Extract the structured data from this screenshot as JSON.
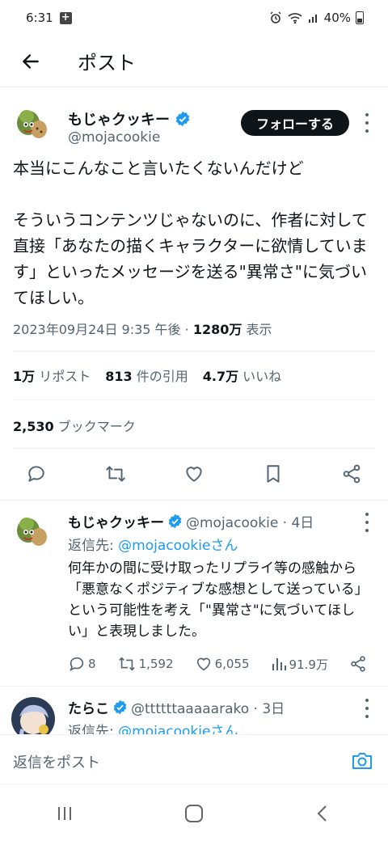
{
  "status_bar": {
    "time": "6:31",
    "battery": "40%"
  },
  "header": {
    "title": "ポスト"
  },
  "post": {
    "author_name": "もじゃクッキー",
    "author_handle": "@mojacookie",
    "follow_label": "フォローする",
    "text": "本当にこんなこと言いたくないんだけど\n\nそういうコンテンツじゃないのに、作者に対して直接「あなたの描くキャラクターに欲情しています」といったメッセージを送る\"異常さ\"に気づいてほしい。",
    "timestamp": "2023年09月24日 9:35 午後 · ",
    "views_count": "1280万",
    "views_label": " 表示",
    "reposts_count": "1万",
    "reposts_label": " リポスト",
    "quotes_count": "813",
    "quotes_label": " 件の引用",
    "likes_count": "4.7万",
    "likes_label": " いいね",
    "bookmarks_count": "2,530",
    "bookmarks_label": " ブックマーク"
  },
  "replies": [
    {
      "name": "もじゃクッキー",
      "handle": "@mojacookie · 4日",
      "reply_to_prefix": "返信先: ",
      "reply_to_link": "@mojacookieさん",
      "text": "何年かの間に受け取ったリプライ等の感触から「悪意なくポジティブな感想として送っている」という可能性を考え「\"異常さ\"に気づいてほしい」と表現しました。",
      "replies": "8",
      "reposts": "1,592",
      "likes": "6,055",
      "views": "91.9万"
    },
    {
      "name": "たらこ",
      "handle": "@ttttttaaaaarako · 3日",
      "reply_to_prefix": "返信先: ",
      "reply_to_link": "@mojacookieさん"
    }
  ],
  "compose": {
    "placeholder": "返信をポスト"
  },
  "colors": {
    "accent": "#1d9bf0",
    "text": "#0f1419",
    "muted": "#536471",
    "verified": "#1d9bf0"
  }
}
